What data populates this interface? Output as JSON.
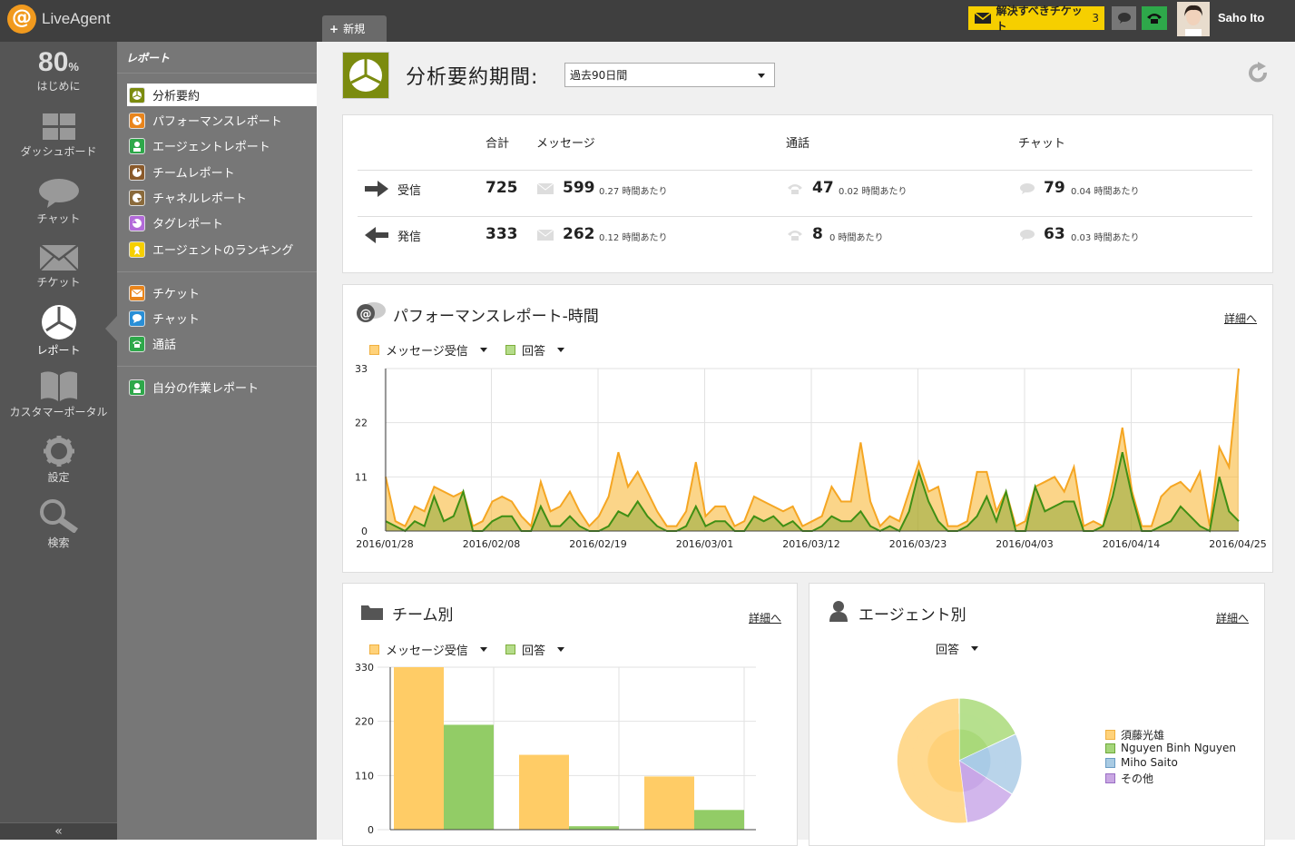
{
  "app": {
    "logo": "LiveAgent",
    "new_tab": "新規",
    "ticket_button": "解決すべきチケット",
    "ticket_count": "3",
    "user": "Saho Ito"
  },
  "nav": {
    "progress": "80",
    "progress_unit": "%",
    "items": [
      "はじめに",
      "ダッシュボード",
      "チャット",
      "チケット",
      "レポート",
      "カスタマーポータル",
      "設定",
      "検索"
    ],
    "collapse": "«"
  },
  "subnav": {
    "header": "レポート",
    "items": [
      "分析要約",
      "パフォーマンスレポート",
      "エージェントレポート",
      "チームレポート",
      "チャネルレポート",
      "タグレポート",
      "エージェントのランキング",
      "チケット",
      "チャット",
      "通話",
      "自分の作業レポート"
    ]
  },
  "page": {
    "title": "分析要約期間:",
    "period": "過去90日間"
  },
  "summary": {
    "headers": {
      "total": "合計",
      "messages": "メッセージ",
      "calls": "通話",
      "chat": "チャット"
    },
    "incoming": {
      "label": "受信",
      "total": "725",
      "messages": "599",
      "messages_rate": "0.27 時間あたり",
      "calls": "47",
      "calls_rate": "0.02 時間あたり",
      "chat": "79",
      "chat_rate": "0.04 時間あたり"
    },
    "outgoing": {
      "label": "発信",
      "total": "333",
      "messages": "262",
      "messages_rate": "0.12 時間あたり",
      "calls": "8",
      "calls_rate": "0 時間あたり",
      "chat": "63",
      "chat_rate": "0.03 時間あたり"
    }
  },
  "perf": {
    "title": "パフォーマンスレポート-時間",
    "detail": "詳細へ",
    "legend_a": "メッセージ受信",
    "legend_b": "回答"
  },
  "team": {
    "title": "チーム別",
    "detail": "詳細へ",
    "legend_a": "メッセージ受信",
    "legend_b": "回答"
  },
  "agent": {
    "title": "エージェント別",
    "detail": "詳細へ",
    "selector": "回答",
    "legend": [
      "須藤光雄",
      "Nguyen Binh Nguyen",
      "Miho Saito",
      "その他"
    ]
  },
  "colors": {
    "received": "#f8b93a",
    "answered": "#5a9e1a",
    "olive": "#7b8b0f"
  },
  "chart_data": [
    {
      "type": "area",
      "title": "パフォーマンスレポート-時間",
      "ylim": [
        0,
        33
      ],
      "yticks": [
        0,
        11,
        22,
        33
      ],
      "xticks": [
        "2016/01/28",
        "2016/02/08",
        "2016/02/19",
        "2016/03/01",
        "2016/03/12",
        "2016/03/23",
        "2016/04/03",
        "2016/04/14",
        "2016/04/25"
      ],
      "series": [
        {
          "name": "メッセージ受信",
          "values": [
            11,
            2,
            1,
            5,
            4,
            9,
            8,
            7,
            8,
            1,
            2,
            6,
            7,
            6,
            3,
            1,
            10,
            4,
            5,
            8,
            4,
            1,
            3,
            7,
            16,
            9,
            12,
            8,
            4,
            1,
            1,
            4,
            14,
            3,
            5,
            5,
            1,
            2,
            7,
            6,
            5,
            4,
            5,
            1,
            2,
            3,
            9,
            6,
            6,
            18,
            6,
            1,
            3,
            2,
            8,
            14,
            8,
            9,
            1,
            1,
            2,
            12,
            12,
            4,
            8,
            1,
            2,
            9,
            10,
            11,
            8,
            13,
            1,
            2,
            1,
            10,
            21,
            8,
            1,
            1,
            7,
            9,
            10,
            8,
            12,
            1,
            17,
            13,
            33
          ]
        },
        {
          "name": "回答",
          "values": [
            2,
            1,
            0,
            2,
            1,
            7,
            2,
            3,
            8,
            0,
            0,
            2,
            3,
            3,
            0,
            0,
            5,
            1,
            1,
            3,
            1,
            0,
            0,
            1,
            4,
            3,
            6,
            3,
            1,
            0,
            0,
            1,
            5,
            1,
            2,
            2,
            0,
            0,
            3,
            2,
            3,
            1,
            2,
            0,
            0,
            1,
            3,
            2,
            2,
            4,
            1,
            0,
            1,
            0,
            4,
            12,
            6,
            2,
            0,
            0,
            1,
            3,
            7,
            2,
            8,
            0,
            0,
            9,
            4,
            5,
            6,
            6,
            0,
            0,
            1,
            7,
            16,
            7,
            0,
            0,
            1,
            2,
            5,
            3,
            1,
            0,
            11,
            4,
            2
          ]
        }
      ]
    },
    {
      "type": "bar",
      "title": "チーム別",
      "ylim": [
        0,
        330
      ],
      "yticks": [
        0,
        110,
        220,
        330
      ],
      "categories": [
        "",
        "",
        ""
      ],
      "series": [
        {
          "name": "メッセージ受信",
          "values": [
            330,
            152,
            108
          ]
        },
        {
          "name": "回答",
          "values": [
            213,
            7,
            40
          ]
        }
      ]
    },
    {
      "type": "pie",
      "title": "エージェント別",
      "categories": [
        "須藤光雄",
        "Nguyen Binh Nguyen",
        "Miho Saito",
        "その他"
      ],
      "values": [
        52,
        18,
        16,
        14
      ]
    }
  ]
}
